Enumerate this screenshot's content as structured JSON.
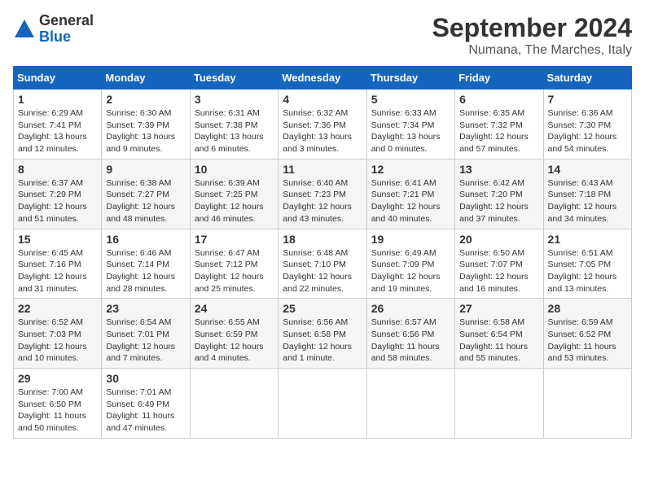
{
  "logo": {
    "general": "General",
    "blue": "Blue"
  },
  "title": "September 2024",
  "subtitle": "Numana, The Marches, Italy",
  "days_header": [
    "Sunday",
    "Monday",
    "Tuesday",
    "Wednesday",
    "Thursday",
    "Friday",
    "Saturday"
  ],
  "weeks": [
    [
      {
        "day": "1",
        "sunrise": "Sunrise: 6:29 AM",
        "sunset": "Sunset: 7:41 PM",
        "daylight": "Daylight: 13 hours and 12 minutes."
      },
      {
        "day": "2",
        "sunrise": "Sunrise: 6:30 AM",
        "sunset": "Sunset: 7:39 PM",
        "daylight": "Daylight: 13 hours and 9 minutes."
      },
      {
        "day": "3",
        "sunrise": "Sunrise: 6:31 AM",
        "sunset": "Sunset: 7:38 PM",
        "daylight": "Daylight: 13 hours and 6 minutes."
      },
      {
        "day": "4",
        "sunrise": "Sunrise: 6:32 AM",
        "sunset": "Sunset: 7:36 PM",
        "daylight": "Daylight: 13 hours and 3 minutes."
      },
      {
        "day": "5",
        "sunrise": "Sunrise: 6:33 AM",
        "sunset": "Sunset: 7:34 PM",
        "daylight": "Daylight: 13 hours and 0 minutes."
      },
      {
        "day": "6",
        "sunrise": "Sunrise: 6:35 AM",
        "sunset": "Sunset: 7:32 PM",
        "daylight": "Daylight: 12 hours and 57 minutes."
      },
      {
        "day": "7",
        "sunrise": "Sunrise: 6:36 AM",
        "sunset": "Sunset: 7:30 PM",
        "daylight": "Daylight: 12 hours and 54 minutes."
      }
    ],
    [
      {
        "day": "8",
        "sunrise": "Sunrise: 6:37 AM",
        "sunset": "Sunset: 7:29 PM",
        "daylight": "Daylight: 12 hours and 51 minutes."
      },
      {
        "day": "9",
        "sunrise": "Sunrise: 6:38 AM",
        "sunset": "Sunset: 7:27 PM",
        "daylight": "Daylight: 12 hours and 48 minutes."
      },
      {
        "day": "10",
        "sunrise": "Sunrise: 6:39 AM",
        "sunset": "Sunset: 7:25 PM",
        "daylight": "Daylight: 12 hours and 46 minutes."
      },
      {
        "day": "11",
        "sunrise": "Sunrise: 6:40 AM",
        "sunset": "Sunset: 7:23 PM",
        "daylight": "Daylight: 12 hours and 43 minutes."
      },
      {
        "day": "12",
        "sunrise": "Sunrise: 6:41 AM",
        "sunset": "Sunset: 7:21 PM",
        "daylight": "Daylight: 12 hours and 40 minutes."
      },
      {
        "day": "13",
        "sunrise": "Sunrise: 6:42 AM",
        "sunset": "Sunset: 7:20 PM",
        "daylight": "Daylight: 12 hours and 37 minutes."
      },
      {
        "day": "14",
        "sunrise": "Sunrise: 6:43 AM",
        "sunset": "Sunset: 7:18 PM",
        "daylight": "Daylight: 12 hours and 34 minutes."
      }
    ],
    [
      {
        "day": "15",
        "sunrise": "Sunrise: 6:45 AM",
        "sunset": "Sunset: 7:16 PM",
        "daylight": "Daylight: 12 hours and 31 minutes."
      },
      {
        "day": "16",
        "sunrise": "Sunrise: 6:46 AM",
        "sunset": "Sunset: 7:14 PM",
        "daylight": "Daylight: 12 hours and 28 minutes."
      },
      {
        "day": "17",
        "sunrise": "Sunrise: 6:47 AM",
        "sunset": "Sunset: 7:12 PM",
        "daylight": "Daylight: 12 hours and 25 minutes."
      },
      {
        "day": "18",
        "sunrise": "Sunrise: 6:48 AM",
        "sunset": "Sunset: 7:10 PM",
        "daylight": "Daylight: 12 hours and 22 minutes."
      },
      {
        "day": "19",
        "sunrise": "Sunrise: 6:49 AM",
        "sunset": "Sunset: 7:09 PM",
        "daylight": "Daylight: 12 hours and 19 minutes."
      },
      {
        "day": "20",
        "sunrise": "Sunrise: 6:50 AM",
        "sunset": "Sunset: 7:07 PM",
        "daylight": "Daylight: 12 hours and 16 minutes."
      },
      {
        "day": "21",
        "sunrise": "Sunrise: 6:51 AM",
        "sunset": "Sunset: 7:05 PM",
        "daylight": "Daylight: 12 hours and 13 minutes."
      }
    ],
    [
      {
        "day": "22",
        "sunrise": "Sunrise: 6:52 AM",
        "sunset": "Sunset: 7:03 PM",
        "daylight": "Daylight: 12 hours and 10 minutes."
      },
      {
        "day": "23",
        "sunrise": "Sunrise: 6:54 AM",
        "sunset": "Sunset: 7:01 PM",
        "daylight": "Daylight: 12 hours and 7 minutes."
      },
      {
        "day": "24",
        "sunrise": "Sunrise: 6:55 AM",
        "sunset": "Sunset: 6:59 PM",
        "daylight": "Daylight: 12 hours and 4 minutes."
      },
      {
        "day": "25",
        "sunrise": "Sunrise: 6:56 AM",
        "sunset": "Sunset: 6:58 PM",
        "daylight": "Daylight: 12 hours and 1 minute."
      },
      {
        "day": "26",
        "sunrise": "Sunrise: 6:57 AM",
        "sunset": "Sunset: 6:56 PM",
        "daylight": "Daylight: 11 hours and 58 minutes."
      },
      {
        "day": "27",
        "sunrise": "Sunrise: 6:58 AM",
        "sunset": "Sunset: 6:54 PM",
        "daylight": "Daylight: 11 hours and 55 minutes."
      },
      {
        "day": "28",
        "sunrise": "Sunrise: 6:59 AM",
        "sunset": "Sunset: 6:52 PM",
        "daylight": "Daylight: 11 hours and 53 minutes."
      }
    ],
    [
      {
        "day": "29",
        "sunrise": "Sunrise: 7:00 AM",
        "sunset": "Sunset: 6:50 PM",
        "daylight": "Daylight: 11 hours and 50 minutes."
      },
      {
        "day": "30",
        "sunrise": "Sunrise: 7:01 AM",
        "sunset": "Sunset: 6:49 PM",
        "daylight": "Daylight: 11 hours and 47 minutes."
      },
      null,
      null,
      null,
      null,
      null
    ]
  ]
}
